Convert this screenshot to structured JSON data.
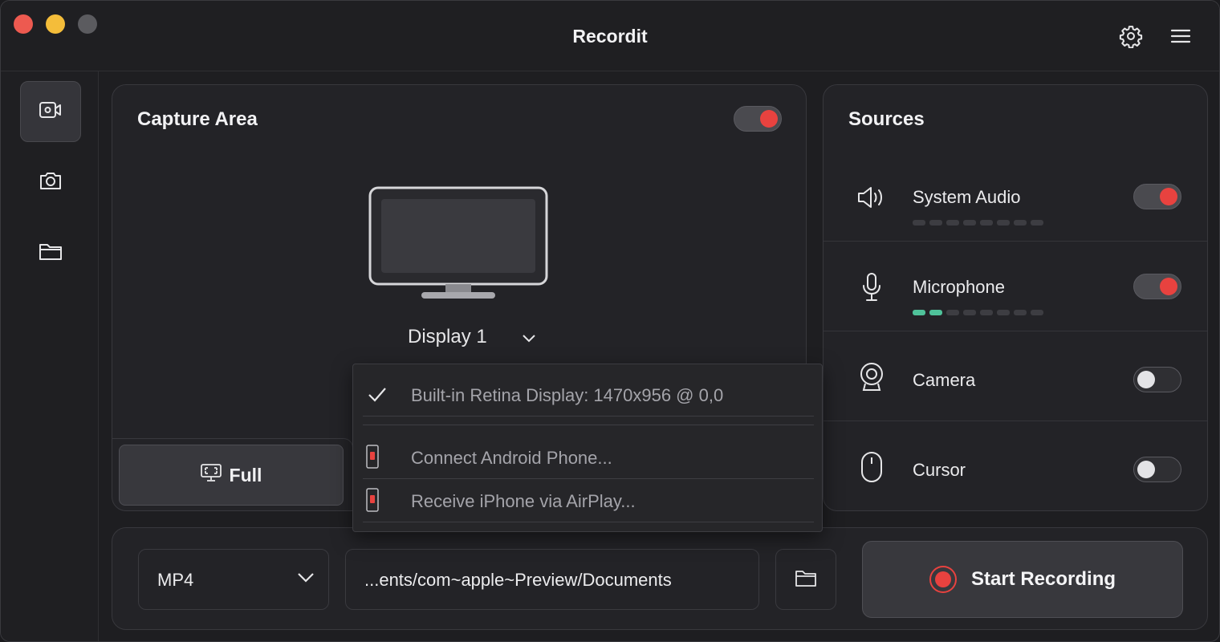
{
  "app": {
    "title": "Recordit"
  },
  "capture": {
    "title": "Capture Area",
    "toggle_on": true,
    "display_label": "Display 1",
    "full_button_label": "Full"
  },
  "dropdown": {
    "items": [
      {
        "label": "Built-in Retina Display: 1470x956 @ 0,0",
        "checked": true
      },
      {
        "label": "Connect Android Phone...",
        "icon": "phone-icon"
      },
      {
        "label": "Receive iPhone via AirPlay...",
        "icon": "phone-icon"
      }
    ]
  },
  "sources": {
    "title": "Sources",
    "items": [
      {
        "label": "System Audio",
        "icon": "speaker-icon",
        "enabled": true,
        "meter_level": 0
      },
      {
        "label": "Microphone",
        "icon": "microphone-icon",
        "enabled": true,
        "meter_level": 2
      },
      {
        "label": "Camera",
        "icon": "webcam-icon",
        "enabled": false
      },
      {
        "label": "Cursor",
        "icon": "mouse-icon",
        "enabled": false
      }
    ]
  },
  "bottom": {
    "format": "MP4",
    "path": "...ents/com~apple~Preview/Documents",
    "record_label": "Start Recording"
  },
  "colors": {
    "accent_red": "#e8423f",
    "meter_green": "#4fc29a"
  }
}
